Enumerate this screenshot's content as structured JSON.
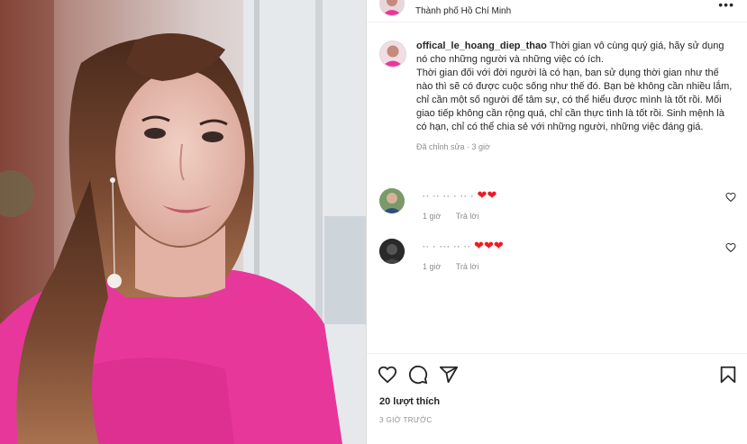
{
  "header": {
    "location": "Thành phố Hồ Chí Minh",
    "more_icon": "more-horizontal-icon"
  },
  "caption": {
    "username": "offical_le_hoang_diep_thao",
    "text": "Thời gian vô cùng quý giá, hãy sử dụng nó cho những người và những việc có ích.\nThời gian đối với đời người là có hạn, ban sử dụng thời gian như thế nào thì sẽ có được cuộc sống như thế đó. Bạn bè không cần nhiều lắm, chỉ cần một số người để tâm sự, có thể hiểu được mình là tốt rồi. Mối giao tiếp không cần rộng quá, chỉ cần thực tình là tốt rồi. Sinh mệnh là có hạn, chỉ có thể chia sẻ với những người, những việc đáng giá.",
    "meta": "Đã chỉnh sửa · 3 giờ"
  },
  "comments": [
    {
      "username": "·· ·· ·· · ·· ·",
      "text": "❤❤",
      "time": "1 giờ",
      "reply": "Trả lời"
    },
    {
      "username": "·· · ··· ·· ··",
      "text": "❤❤❤",
      "time": "1 giờ",
      "reply": "Trả lời"
    }
  ],
  "actions": {
    "like_icon": "heart-icon",
    "comment_icon": "comment-icon",
    "share_icon": "send-icon",
    "save_icon": "bookmark-icon"
  },
  "likes": "20 lượt thích",
  "time_ago": "3 GIỜ TRƯỚC",
  "colors": {
    "heart": "#ed1c24",
    "muted": "#8e8e8e",
    "text": "#262626",
    "dress": "#e8379a"
  }
}
